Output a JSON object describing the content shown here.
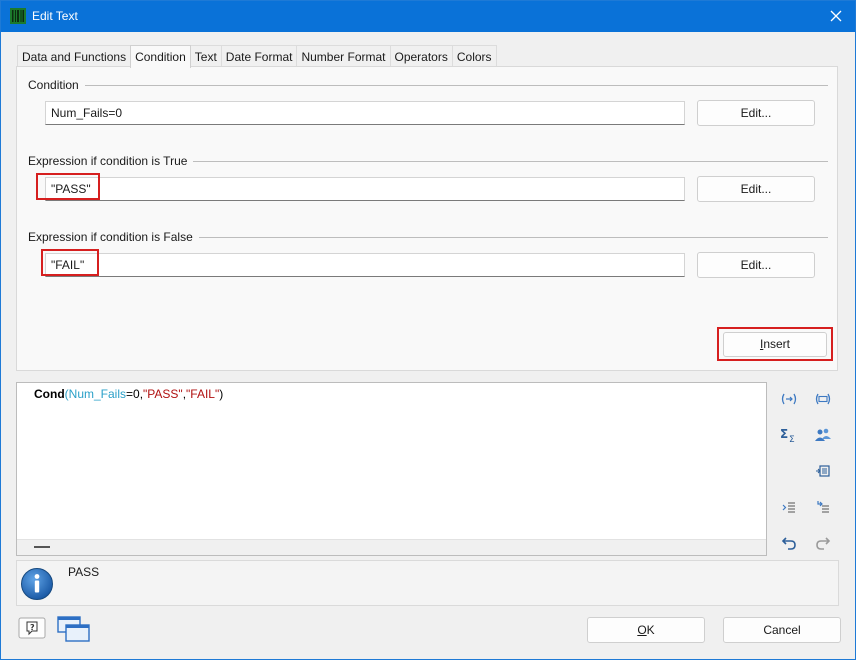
{
  "window": {
    "title": "Edit Text",
    "close_glyph": "✕",
    "app_icon": "barcode-report-icon",
    "accent": "#0a72d8"
  },
  "tabs": [
    {
      "label": "Data and Functions",
      "active": false
    },
    {
      "label": "Condition",
      "active": true
    },
    {
      "label": "Text",
      "active": false
    },
    {
      "label": "Date Format",
      "active": false
    },
    {
      "label": "Number Format",
      "active": false
    },
    {
      "label": "Operators",
      "active": false
    },
    {
      "label": "Colors",
      "active": false
    }
  ],
  "condition": {
    "group_label": "Condition",
    "value": "Num_Fails=0",
    "edit_label": "Edit..."
  },
  "true_expr": {
    "group_label": "Expression if condition is True",
    "value": "\"PASS\"",
    "edit_label": "Edit..."
  },
  "false_expr": {
    "group_label": "Expression if condition is False",
    "value": "\"FAIL\"",
    "edit_label": "Edit..."
  },
  "insert_button": {
    "label_rest": "nsert",
    "label_key": "I"
  },
  "editor": {
    "fn": "Cond",
    "open": "(",
    "var": "Num_Fails",
    "op_num": "=0,",
    "s1": "\"PASS\"",
    "comma": ",",
    "s2": "\"FAIL\"",
    "close": ")"
  },
  "toolbar_icons": [
    "insert-field-icon",
    "insert-text-block-icon",
    "sum-icon",
    "users-icon",
    "insert-list-icon",
    "indent-icon",
    "outdent-icon",
    "undo-icon",
    "redo-icon"
  ],
  "info": {
    "text": "PASS",
    "icon": "info-icon"
  },
  "footer": {
    "ok_key": "O",
    "ok_rest": "K",
    "cancel_label": "Cancel",
    "help_icon": "help-icon",
    "windows_icon": "cascade-windows-icon"
  },
  "highlight_color": "#d61f1f"
}
